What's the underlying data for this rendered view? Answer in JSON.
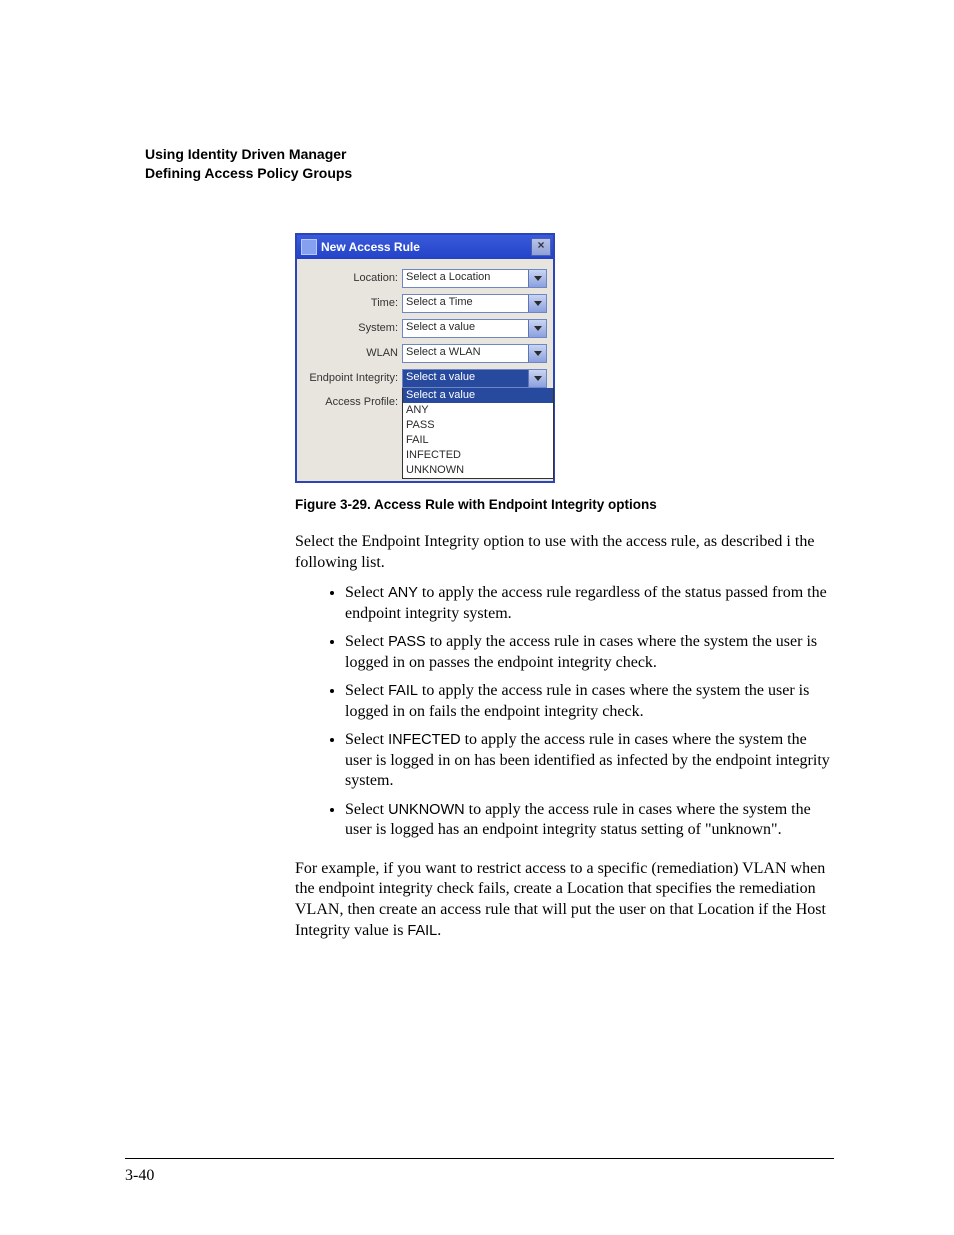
{
  "header": {
    "line1": "Using Identity Driven Manager",
    "line2": "Defining Access Policy Groups"
  },
  "dialog": {
    "title": "New Access Rule",
    "close_glyph": "×",
    "fields": [
      {
        "label": "Location:",
        "value": "Select a Location"
      },
      {
        "label": "Time:",
        "value": "Select a Time"
      },
      {
        "label": "System:",
        "value": "Select a value"
      },
      {
        "label": "WLAN",
        "value": "Select a WLAN"
      },
      {
        "label": "Endpoint Integrity:",
        "value": "Select a value",
        "highlighted": true
      }
    ],
    "access_profile_label": "Access Profile:",
    "options": [
      "Select a value",
      "ANY",
      "PASS",
      "FAIL",
      "INFECTED",
      "UNKNOWN"
    ],
    "selected_option": "Select a value"
  },
  "figure_caption": "Figure 3-29. Access Rule with Endpoint Integrity options",
  "intro_p": "Select the Endpoint Integrity option to use with the access rule, as described i the following list.",
  "bullets": [
    {
      "kw": "ANY",
      "pre": "Select ",
      "post": " to apply the access rule regardless of the status passed from the endpoint integrity system."
    },
    {
      "kw": "PASS",
      "pre": "Select ",
      "post": " to apply the access rule in cases where the system the user is logged in on passes the endpoint integrity check."
    },
    {
      "kw": "FAIL",
      "pre": "Select ",
      "post": " to apply the access rule in cases where the system the user is logged in on fails the endpoint integrity check."
    },
    {
      "kw": "INFECTED",
      "pre": "Select ",
      "post": " to apply the access rule in cases where the system the user is logged in on has been identified as infected by the endpoint integrity system."
    },
    {
      "kw": "UNKNOWN",
      "pre": "Select ",
      "post": " to apply the access rule in cases where the system the user is logged has an endpoint integrity status setting of \"unknown\"."
    }
  ],
  "example_p_pre": "For example, if you want to restrict access to a specific (remediation) VLAN when the endpoint integrity check fails, create a Location that specifies the remediation VLAN, then create an access rule that will put the user on that Location if the Host Integrity value is ",
  "example_kw": "FAIL",
  "example_post": ".",
  "page_number": "3-40"
}
